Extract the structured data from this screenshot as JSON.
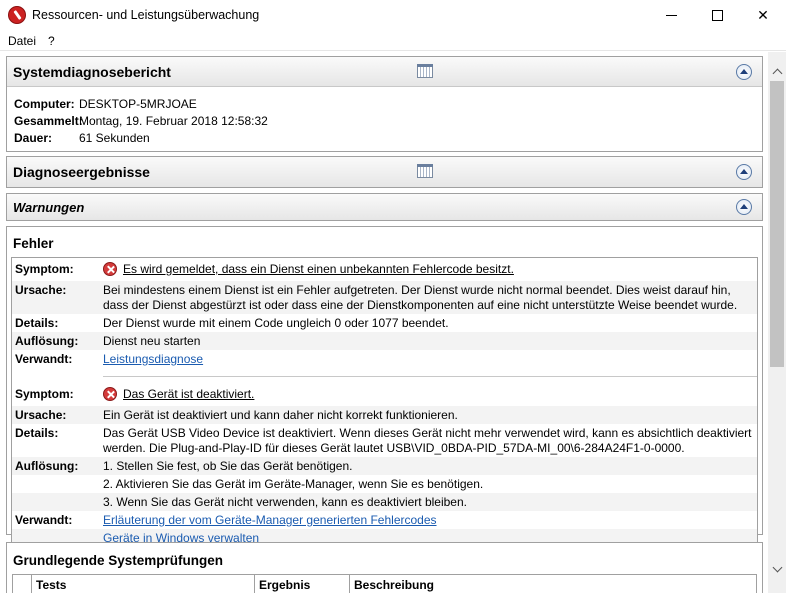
{
  "window": {
    "title": "Ressourcen- und Leistungsüberwachung",
    "minimize": "",
    "maximize": "",
    "close": "✕"
  },
  "menu": {
    "file": "Datei",
    "help": "?"
  },
  "systemreport": {
    "title": "Systemdiagnosebericht",
    "rows": [
      {
        "label": "Computer:",
        "value": "DESKTOP-5MRJOAE"
      },
      {
        "label": "Gesammelt:",
        "value": "Montag, 19. Februar 2018 12:58:32"
      },
      {
        "label": "Dauer:",
        "value": "61 Sekunden"
      }
    ]
  },
  "diagnose": {
    "title": "Diagnoseergebnisse"
  },
  "warnings": {
    "title": "Warnungen"
  },
  "errors": {
    "title": "Fehler",
    "labels": {
      "symptom": "Symptom:",
      "cause": "Ursache:",
      "details": "Details:",
      "resolution": "Auflösung:",
      "related": "Verwandt:"
    },
    "items": [
      {
        "symptom": "Es wird gemeldet, dass ein Dienst einen unbekannten Fehlercode besitzt.",
        "cause": "Bei mindestens einem Dienst ist ein Fehler aufgetreten. Der Dienst wurde nicht normal beendet. Dies weist darauf hin, dass der Dienst abgestürzt ist oder dass eine der Dienstkomponenten auf eine nicht unterstützte Weise beendet wurde.",
        "details": "Der Dienst wurde mit einem Code ungleich 0 oder 1077 beendet.",
        "resolution": [
          "Dienst neu starten"
        ],
        "related": [
          "Leistungsdiagnose"
        ]
      },
      {
        "symptom": "Das Gerät ist deaktiviert.",
        "cause": "Ein Gerät ist deaktiviert und kann daher nicht korrekt funktionieren.",
        "details": "Das Gerät USB Video Device ist deaktiviert. Wenn dieses Gerät nicht mehr verwendet wird, kann es absichtlich deaktiviert werden. Die Plug-and-Play-ID für dieses Gerät lautet USB\\VID_0BDA-PID_57DA-MI_00\\6-284A24F1-0-0000.",
        "resolution": [
          "1. Stellen Sie fest, ob Sie das Gerät benötigen.",
          "2. Aktivieren Sie das Gerät im Geräte-Manager, wenn Sie es benötigen.",
          "3. Wenn Sie das Gerät nicht verwenden, kann es deaktiviert bleiben."
        ],
        "related": [
          "Erläuterung der vom Geräte-Manager generierten Fehlercodes",
          "Geräte in Windows verwalten"
        ]
      }
    ]
  },
  "basicchecks": {
    "title": "Grundlegende Systemprüfungen",
    "columns": [
      "Tests",
      "Ergebnis",
      "Beschreibung"
    ]
  }
}
